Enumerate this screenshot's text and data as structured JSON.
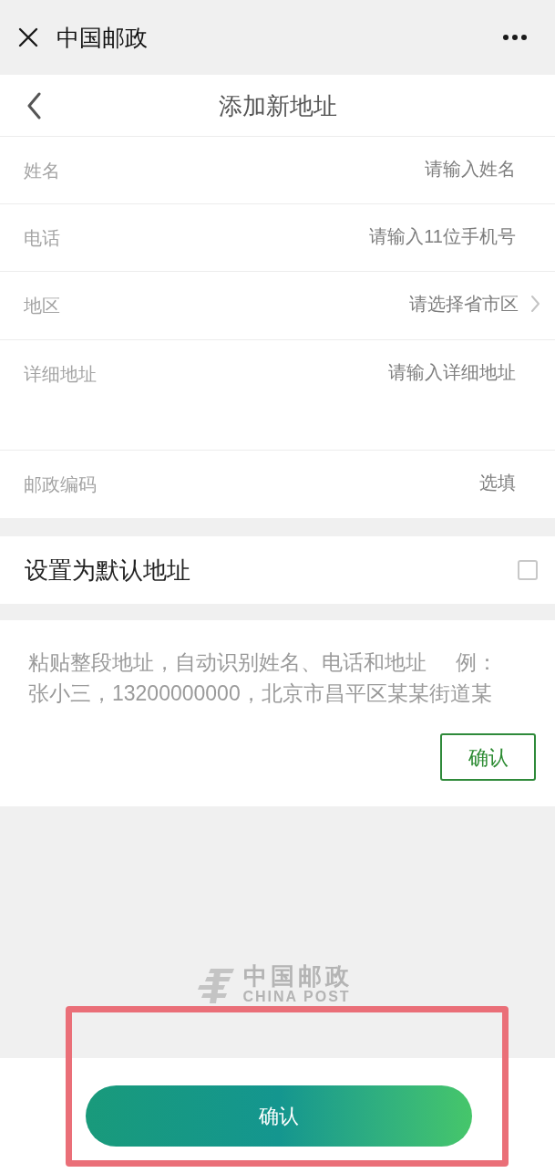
{
  "top_bar": {
    "title": "中国邮政"
  },
  "header": {
    "title": "添加新地址"
  },
  "form": {
    "fields": [
      {
        "kind": "text",
        "label": "姓名",
        "placeholder": "请输入姓名"
      },
      {
        "kind": "phone",
        "label": "电话",
        "placeholder": "请输入11位手机号"
      },
      {
        "kind": "picker",
        "label": "地区",
        "placeholder": "请选择省市区"
      },
      {
        "kind": "multiline",
        "label": "详细地址",
        "placeholder": "请输入详细地址"
      },
      {
        "kind": "text",
        "label": "邮政编码",
        "placeholder": "选填"
      }
    ]
  },
  "default_address": {
    "label": "设置为默认地址",
    "checked": false
  },
  "paste_box": {
    "placeholder": "粘贴整段地址，自动识别姓名、电话和地址     例：张小三，13200000000，北京市昌平区某某街道某",
    "button": "确认"
  },
  "footer_logo": {
    "title": "中国邮政",
    "subtitle": "CHINA POST"
  },
  "submit_button": {
    "label": "确认"
  }
}
